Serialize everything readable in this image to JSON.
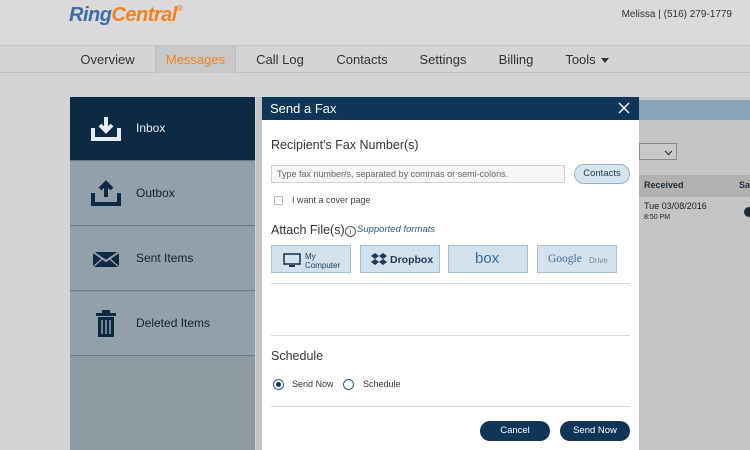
{
  "header": {
    "brand_ring": "Ring",
    "brand_central": "Central",
    "brand_mark": "®",
    "user_info": "Melissa | (516) 279-1779"
  },
  "nav": {
    "items": [
      {
        "label": "Overview"
      },
      {
        "label": "Messages"
      },
      {
        "label": "Call Log"
      },
      {
        "label": "Contacts"
      },
      {
        "label": "Settings"
      },
      {
        "label": "Billing"
      },
      {
        "label": "Tools"
      }
    ],
    "active": "Messages"
  },
  "folders": [
    {
      "label": "Inbox",
      "icon": "inbox-icon"
    },
    {
      "label": "Outbox",
      "icon": "outbox-icon"
    },
    {
      "label": "Sent Items",
      "icon": "envelope-icon"
    },
    {
      "label": "Deleted Items",
      "icon": "trash-icon"
    }
  ],
  "background_table": {
    "header_received": "Received",
    "header_partial": "Sa",
    "row_date": "Tue 03/08/2016",
    "row_time": "8:50 PM"
  },
  "dialog": {
    "title": "Send a Fax",
    "recipient_label": "Recipient's Fax Number(s)",
    "fax_placeholder": "Type fax number/s, separated by commas or semi-colons.",
    "contacts_button": "Contacts",
    "cover_page_label": "I want a cover page",
    "attach_label": "Attach File(s)",
    "info_glyph": "i",
    "supported_formats_link": "Supported formats",
    "sources": {
      "my_computer_line1": "My",
      "my_computer_line2": "Computer",
      "dropbox": "Dropbox",
      "box": "box",
      "google_drive_prefix": "Google",
      "google_drive_suffix": "Drive"
    },
    "schedule_label": "Schedule",
    "schedule_options": [
      {
        "label": "Send Now",
        "selected": true
      },
      {
        "label": "Schedule",
        "selected": false
      }
    ],
    "cancel_button": "Cancel",
    "send_button": "Send Now"
  },
  "colors": {
    "brand_blue": "#3f6da9",
    "brand_orange": "#f58220",
    "dialog_header": "#0f3557",
    "active_folder": "#0d2a45"
  }
}
